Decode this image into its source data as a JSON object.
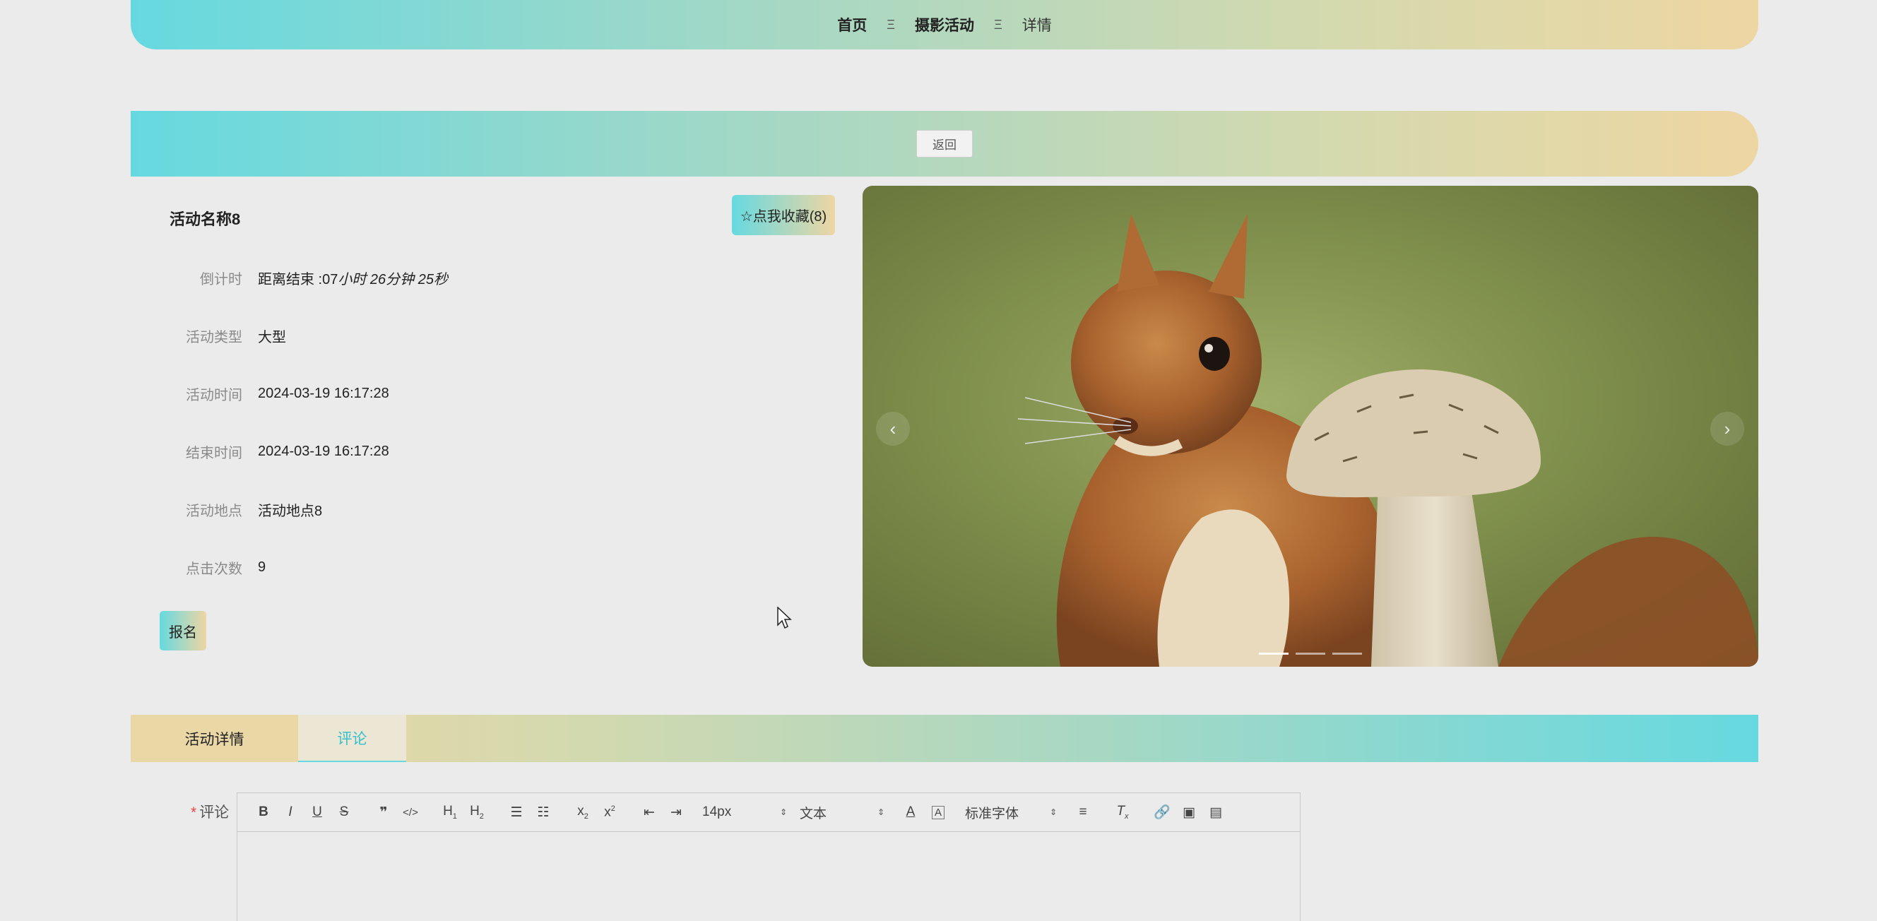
{
  "breadcrumb": {
    "items": [
      "首页",
      "摄影活动",
      "详情"
    ],
    "separator": "Ξ"
  },
  "back_button": "返回",
  "activity": {
    "title": "活动名称8",
    "favorite_button": "☆点我收藏(8)",
    "fields": [
      {
        "label": "倒计时",
        "value_prefix": "距离结束 :07",
        "value_italic": "小时 26分钟 25秒"
      },
      {
        "label": "活动类型",
        "value": "大型"
      },
      {
        "label": "活动时间",
        "value": "2024-03-19 16:17:28"
      },
      {
        "label": "结束时间",
        "value": "2024-03-19 16:17:28"
      },
      {
        "label": "活动地点",
        "value": "活动地点8"
      },
      {
        "label": "点击次数",
        "value": "9"
      }
    ],
    "signup_button": "报名"
  },
  "carousel": {
    "prev": "‹",
    "next": "›",
    "slide_count": 3,
    "active_index": 0
  },
  "tabs": [
    "活动详情",
    "评论"
  ],
  "comment": {
    "label": "评论",
    "required_mark": "*",
    "toolbar": {
      "font_size": "14px",
      "paragraph": "文本",
      "font_family": "标准字体"
    }
  },
  "colors": {
    "gradient_start": "#66d9e0",
    "gradient_end": "#eed6a3",
    "active_tab_text": "#33c0cc"
  }
}
